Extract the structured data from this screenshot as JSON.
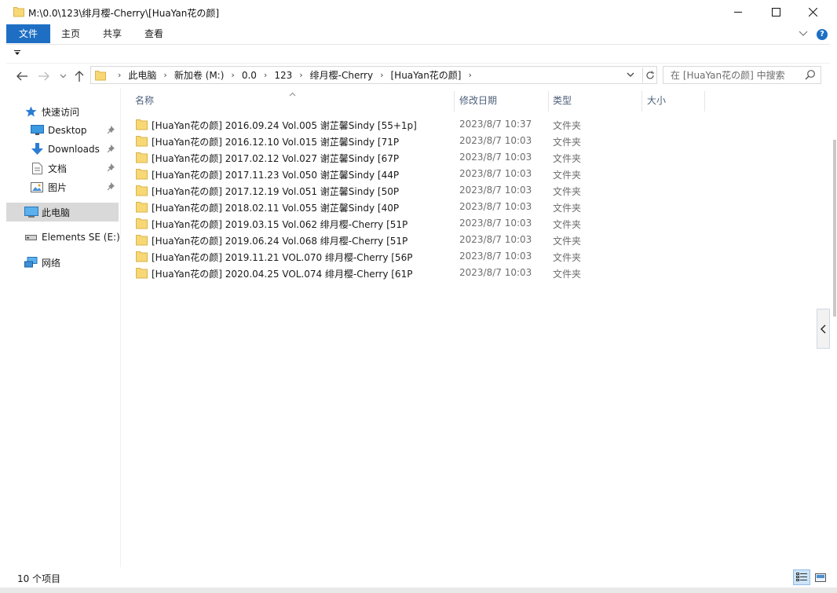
{
  "window": {
    "title": "M:\\0.0\\123\\绯月樱-Cherry\\[HuaYan花の颜]"
  },
  "ribbon": {
    "tabs": [
      "文件",
      "主页",
      "共享",
      "查看"
    ],
    "help_label": "?"
  },
  "address": {
    "crumbs": [
      "此电脑",
      "新加卷 (M:)",
      "0.0",
      "123",
      "绯月樱-Cherry",
      "[HuaYan花の颜]"
    ],
    "search_placeholder": "在 [HuaYan花の颜] 中搜索"
  },
  "nav": {
    "quick_access": "快速访问",
    "items": [
      {
        "label": "Desktop",
        "icon": "desktop-icon",
        "pinned": true
      },
      {
        "label": "Downloads",
        "icon": "downloads-icon",
        "pinned": true
      },
      {
        "label": "文档",
        "icon": "documents-icon",
        "pinned": true
      },
      {
        "label": "图片",
        "icon": "pictures-icon",
        "pinned": true
      }
    ],
    "this_pc": "此电脑",
    "drive": "Elements SE (E:)",
    "network": "网络"
  },
  "columns": {
    "name": "名称",
    "date": "修改日期",
    "type": "类型",
    "size": "大小"
  },
  "files": [
    {
      "name": "[HuaYan花の颜] 2016.09.24 Vol.005 谢芷馨Sindy [55+1p]",
      "date": "2023/8/7 10:37",
      "type": "文件夹"
    },
    {
      "name": "[HuaYan花の颜] 2016.12.10 Vol.015 谢芷馨Sindy [71P",
      "date": "2023/8/7 10:03",
      "type": "文件夹"
    },
    {
      "name": "[HuaYan花の颜] 2017.02.12 Vol.027 谢芷馨Sindy [67P",
      "date": "2023/8/7 10:03",
      "type": "文件夹"
    },
    {
      "name": "[HuaYan花の颜] 2017.11.23 Vol.050 谢芷馨Sindy [44P",
      "date": "2023/8/7 10:03",
      "type": "文件夹"
    },
    {
      "name": "[HuaYan花の颜] 2017.12.19 Vol.051 谢芷馨Sindy [50P",
      "date": "2023/8/7 10:03",
      "type": "文件夹"
    },
    {
      "name": "[HuaYan花の颜] 2018.02.11 Vol.055 谢芷馨Sindy [40P",
      "date": "2023/8/7 10:03",
      "type": "文件夹"
    },
    {
      "name": "[HuaYan花の颜] 2019.03.15 Vol.062 绯月樱-Cherry [51P",
      "date": "2023/8/7 10:03",
      "type": "文件夹"
    },
    {
      "name": "[HuaYan花の颜] 2019.06.24 Vol.068 绯月樱-Cherry [51P",
      "date": "2023/8/7 10:03",
      "type": "文件夹"
    },
    {
      "name": "[HuaYan花の颜] 2019.11.21 VOL.070 绯月樱-Cherry [56P",
      "date": "2023/8/7 10:03",
      "type": "文件夹"
    },
    {
      "name": "[HuaYan花の颜] 2020.04.25 VOL.074 绯月樱-Cherry [61P",
      "date": "2023/8/7 10:03",
      "type": "文件夹"
    }
  ],
  "status": {
    "count": "10 个项目"
  },
  "colors": {
    "accent": "#1e6fc4",
    "folder": "#f8d775",
    "selection": "#d9d9d9"
  }
}
